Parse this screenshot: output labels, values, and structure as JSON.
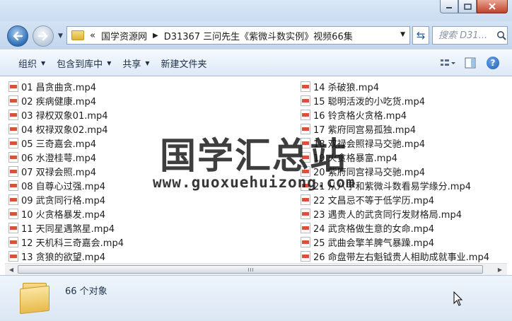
{
  "window": {
    "controls": [
      "minimize-icon",
      "maximize-icon",
      "close-icon"
    ]
  },
  "nav": {
    "back": "back-arrow-icon",
    "forward": "forward-arrow-icon",
    "breadcrumb": {
      "overflow": "«",
      "items": [
        "国学资源网",
        "D31367 三问先生《紫微斗数实例》视频66集"
      ]
    },
    "search_placeholder": "搜索 D31..."
  },
  "toolbar": {
    "organize": "组织",
    "include_library": "包含到库中",
    "share": "共享",
    "new_folder": "新建文件夹"
  },
  "files": {
    "left": [
      "01 昌贪曲贪.mp4",
      "02 疾病健康.mp4",
      "03 禄权双象01.mp4",
      "04 权禄双象02.mp4",
      "05 三奇嘉会.mp4",
      "06 水澄桂萼.mp4",
      "07 双禄会照.mp4",
      "08 自尊心过强.mp4",
      "09 武贪同行格.mp4",
      "10 火贪格暴发.mp4",
      "11 天同星遇煞星.mp4",
      "12 天机科三奇嘉会.mp4",
      "13 贪狼的欲望.mp4"
    ],
    "right": [
      "14 杀破狼.mp4",
      "15 聪明活泼的小吃货.mp4",
      "16 铃贪格火贪格.mp4",
      "17 紫府同宫易孤独.mp4",
      "18 双禄会照禄马交驰.mp4",
      "19 火贪格暴富.mp4",
      "20 紫府同宫禄马交驰.mp4",
      "21 从八字和紫微斗数看易学缘分.mp4",
      "22 文昌忌不等于低学历.mp4",
      "23 遇贵人的武贪同行发财格局.mp4",
      "24 武贪格做生意的女命.mp4",
      "25 武曲会擎羊脾气暴躁.mp4",
      "26 命盘带左右魁钺贵人相助成就事业.mp4"
    ]
  },
  "watermark": {
    "chinese": "国学汇总站",
    "url": "www.guoxuehuizong.com"
  },
  "status": {
    "count": "66 个对象"
  }
}
